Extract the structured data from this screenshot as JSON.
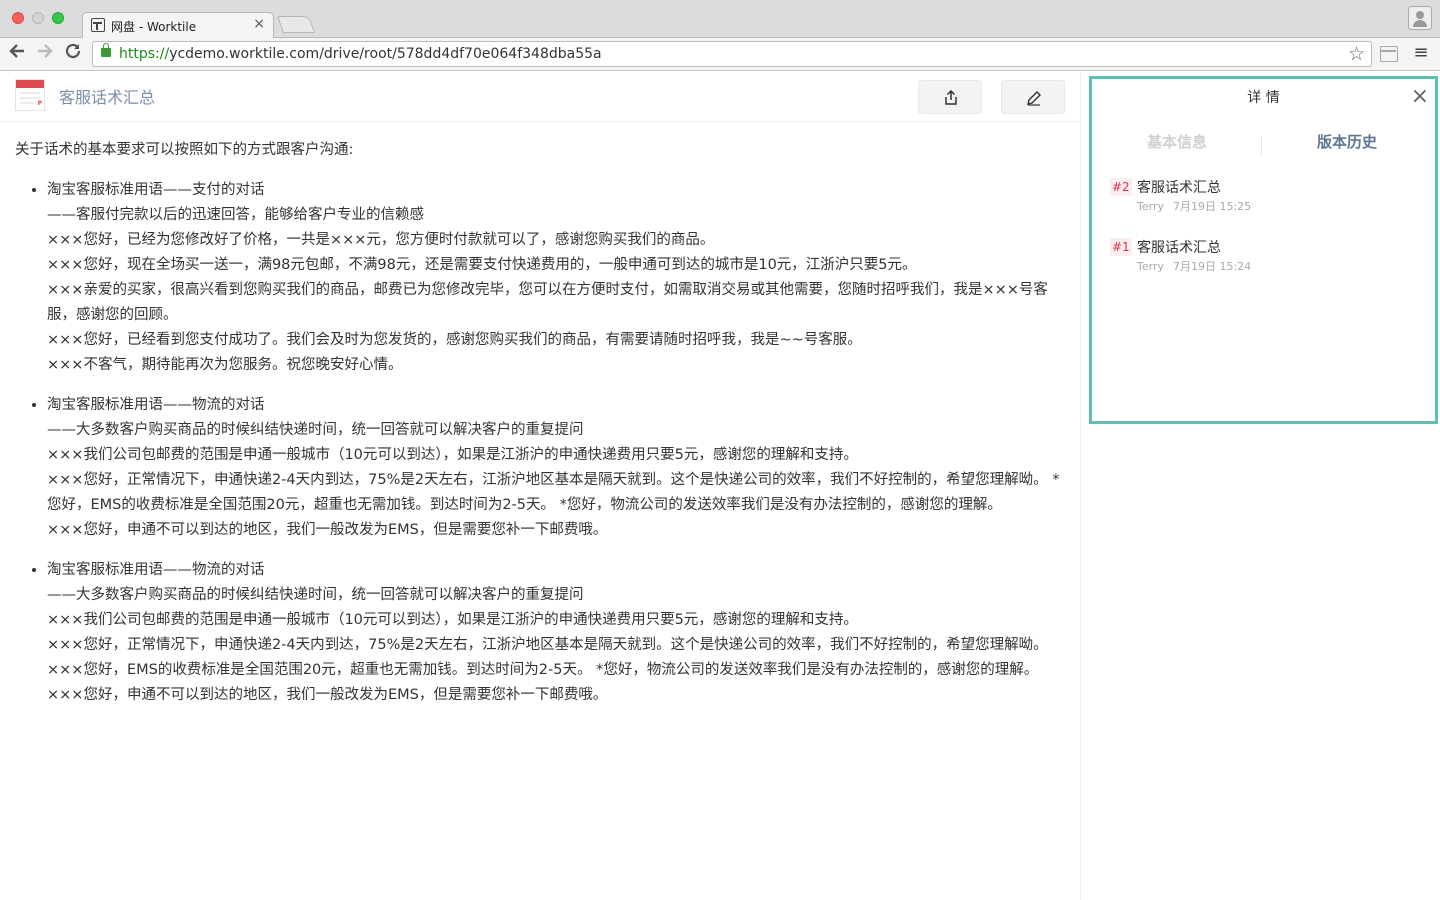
{
  "browser": {
    "tab_title": "网盘 - Worktile",
    "tab_close": "×",
    "url_protocol": "https://",
    "url_rest": "ycdemo.worktile.com/drive/root/578dd4df70e064f348dba55a"
  },
  "header": {
    "file_title": "客服话术汇总"
  },
  "document": {
    "intro": "关于话术的基本要求可以按照如下的方式跟客户沟通:",
    "sections": [
      {
        "lines": [
          "淘宝客服标准用语——支付的对话",
          "——客服付完款以后的迅速回答，能够给客户专业的信赖感",
          "×××您好，已经为您修改好了价格，一共是×××元，您方便时付款就可以了，感谢您购买我们的商品。",
          "×××您好，现在全场买一送一，满98元包邮，不满98元，还是需要支付快递费用的，一般申通可到达的城市是10元，江浙沪只要5元。",
          "×××亲爱的买家，很高兴看到您购买我们的商品，邮费已为您修改完毕，您可以在方便时支付，如需取消交易或其他需要，您随时招呼我们，我是×××号客服，感谢您的回顾。",
          "×××您好，已经看到您支付成功了。我们会及时为您发货的，感谢您购买我们的商品，有需要请随时招呼我，我是~~号客服。",
          "×××不客气，期待能再次为您服务。祝您晚安好心情。"
        ]
      },
      {
        "lines": [
          "淘宝客服标准用语——物流的对话",
          "——大多数客户购买商品的时候纠结快递时间，统一回答就可以解决客户的重复提问",
          "×××我们公司包邮费的范围是申通一般城市（10元可以到达），如果是江浙沪的申通快递费用只要5元，感谢您的理解和支持。",
          "×××您好，正常情况下，申通快递2-4天内到达，75%是2天左右，江浙沪地区基本是隔天就到。这个是快递公司的效率，我们不好控制的，希望您理解呦。 *您好，EMS的收费标准是全国范围20元，超重也无需加钱。到达时间为2-5天。 *您好，物流公司的发送效率我们是没有办法控制的，感谢您的理解。",
          "×××您好，申通不可以到达的地区，我们一般改发为EMS，但是需要您补一下邮费哦。"
        ]
      },
      {
        "lines": [
          "淘宝客服标准用语——物流的对话",
          "——大多数客户购买商品的时候纠结快递时间，统一回答就可以解决客户的重复提问",
          "×××我们公司包邮费的范围是申通一般城市（10元可以到达），如果是江浙沪的申通快递费用只要5元，感谢您的理解和支持。",
          "×××您好，正常情况下，申通快递2-4天内到达，75%是2天左右，江浙沪地区基本是隔天就到。这个是快递公司的效率，我们不好控制的，希望您理解呦。",
          "×××您好，EMS的收费标准是全国范围20元，超重也无需加钱。到达时间为2-5天。 *您好，物流公司的发送效率我们是没有办法控制的，感谢您的理解。",
          "×××您好，申通不可以到达的地区，我们一般改发为EMS，但是需要您补一下邮费哦。"
        ]
      }
    ]
  },
  "detail": {
    "title": "详 情",
    "close": "×",
    "tab_basic": "基本信息",
    "tab_history": "版本历史",
    "versions": [
      {
        "num": "#2",
        "name": "客服话术汇总",
        "user": "Terry",
        "time": "7月19日 15:25"
      },
      {
        "num": "#1",
        "name": "客服话术汇总",
        "user": "Terry",
        "time": "7月19日 15:24"
      }
    ]
  },
  "colors": {
    "accent_border": "#5bbfb2",
    "version_num": "#d2374a",
    "title_link": "#7a8fa8"
  }
}
